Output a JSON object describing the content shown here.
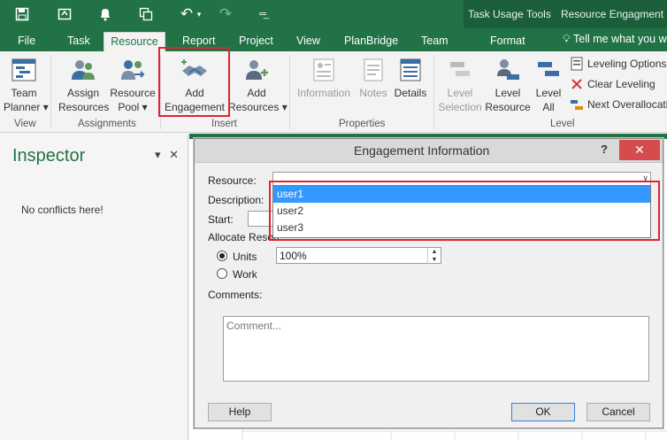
{
  "contextual": {
    "task_usage_tools": "Task Usage Tools",
    "resource_engagement": "Resource Engagment ..."
  },
  "tabs": [
    {
      "label": "File"
    },
    {
      "label": "Task"
    },
    {
      "label": "Resource",
      "active": true
    },
    {
      "label": "Report"
    },
    {
      "label": "Project"
    },
    {
      "label": "View"
    },
    {
      "label": "PlanBridge"
    },
    {
      "label": "Team"
    },
    {
      "label": "Format"
    }
  ],
  "tell_me": "Tell me what you w",
  "ribbon": {
    "team_planner": [
      "Team",
      "Planner ▾"
    ],
    "assign_resources": [
      "Assign",
      "Resources"
    ],
    "resource_pool": [
      "Resource",
      "Pool ▾"
    ],
    "add_engagement": [
      "Add",
      "Engagement"
    ],
    "add_resources": [
      "Add",
      "Resources ▾"
    ],
    "information": "Information",
    "notes": "Notes",
    "details": "Details",
    "level_selection": [
      "Level",
      "Selection"
    ],
    "level_resource": [
      "Level",
      "Resource"
    ],
    "level_all": [
      "Level",
      "All"
    ],
    "leveling_options": "Leveling Options",
    "clear_leveling": "Clear Leveling",
    "next_overallocation": "Next Overallocatio",
    "groups": {
      "view": "View",
      "assignments": "Assignments",
      "insert": "Insert",
      "properties": "Properties",
      "level": "Level"
    }
  },
  "inspector": {
    "title": "Inspector",
    "message": "No conflicts here!"
  },
  "dialog": {
    "title": "Engagement Information",
    "help_glyph": "?",
    "close_glyph": "✕",
    "resource_label": "Resource:",
    "description_label": "Description:",
    "start_label": "Start:",
    "allocate_label": "Allocate Resou",
    "units_label": "Units",
    "work_label": "Work",
    "units_value": "100%",
    "comments_label": "Comments:",
    "comment_placeholder": "Comment...",
    "help_button": "Help",
    "ok_button": "OK",
    "cancel_button": "Cancel",
    "resource_options": [
      "user1",
      "user2",
      "user3"
    ],
    "selected_option": "user1"
  },
  "colors": {
    "brand": "#217346",
    "highlight": "#e0232d",
    "selection": "#3399ff"
  }
}
